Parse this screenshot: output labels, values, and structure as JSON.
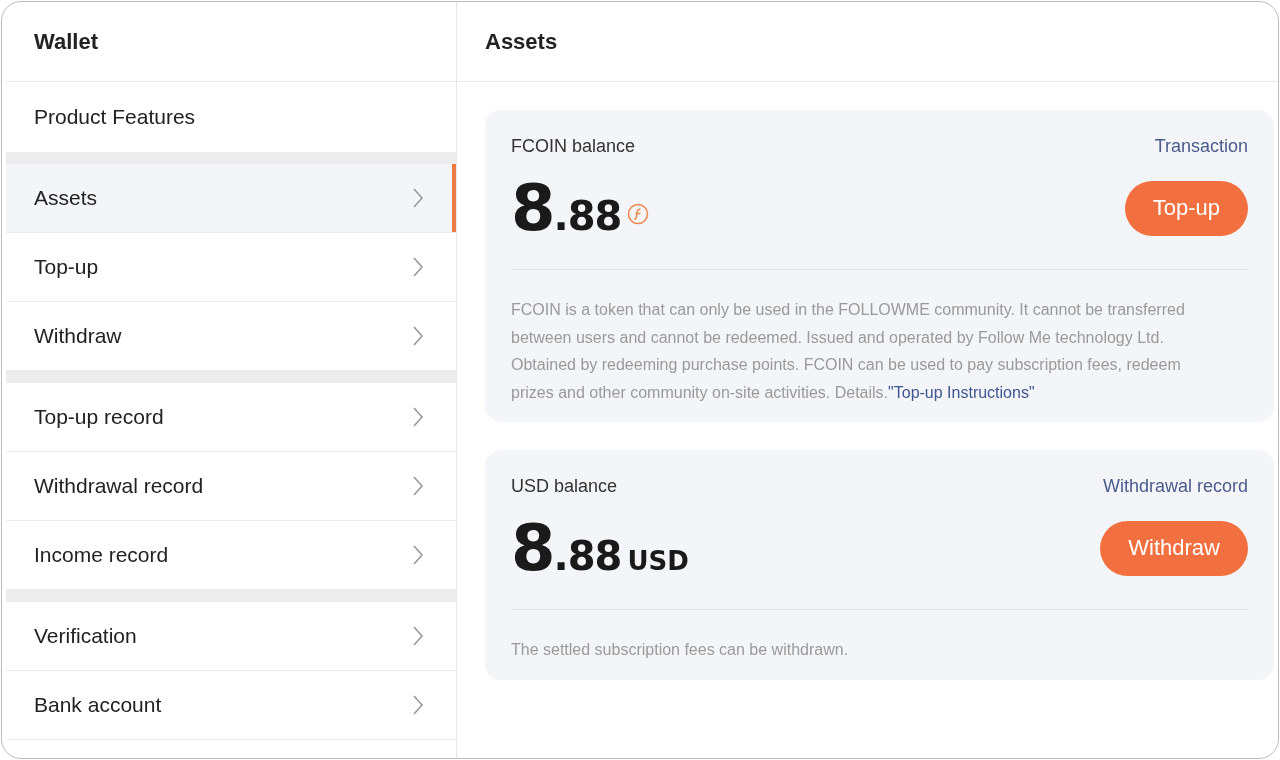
{
  "sidebar": {
    "title": "Wallet",
    "account": "Product Features",
    "groups": [
      {
        "items": [
          {
            "label": "Assets",
            "selected": true
          },
          {
            "label": "Top-up",
            "selected": false
          },
          {
            "label": "Withdraw",
            "selected": false
          }
        ]
      },
      {
        "items": [
          {
            "label": "Top-up record",
            "selected": false
          },
          {
            "label": "Withdrawal record",
            "selected": false
          },
          {
            "label": "Income record",
            "selected": false
          }
        ]
      },
      {
        "items": [
          {
            "label": "Verification",
            "selected": false
          },
          {
            "label": "Bank account",
            "selected": false
          }
        ]
      }
    ]
  },
  "main": {
    "title": "Assets",
    "cards": [
      {
        "kind": "coin",
        "label": "FCOIN balance",
        "link": "Transaction",
        "integer": "8",
        "decimal": ".88",
        "button": "Top-up",
        "description": "FCOIN is a token that can only be used in the FOLLOWME community. It cannot be transferred between users and cannot be redeemed. Issued and operated by Follow Me technology Ltd. Obtained by redeeming purchase points. FCOIN can be used to pay subscription fees, redeem prizes and other community on-site activities. Details.",
        "description_link": "\"Top-up Instructions\""
      },
      {
        "kind": "currency",
        "label": "USD balance",
        "link": "Withdrawal record",
        "integer": "8",
        "decimal": ".88",
        "unit": "USD",
        "button": "Withdraw",
        "description": "The settled subscription fees can be withdrawn."
      }
    ]
  }
}
